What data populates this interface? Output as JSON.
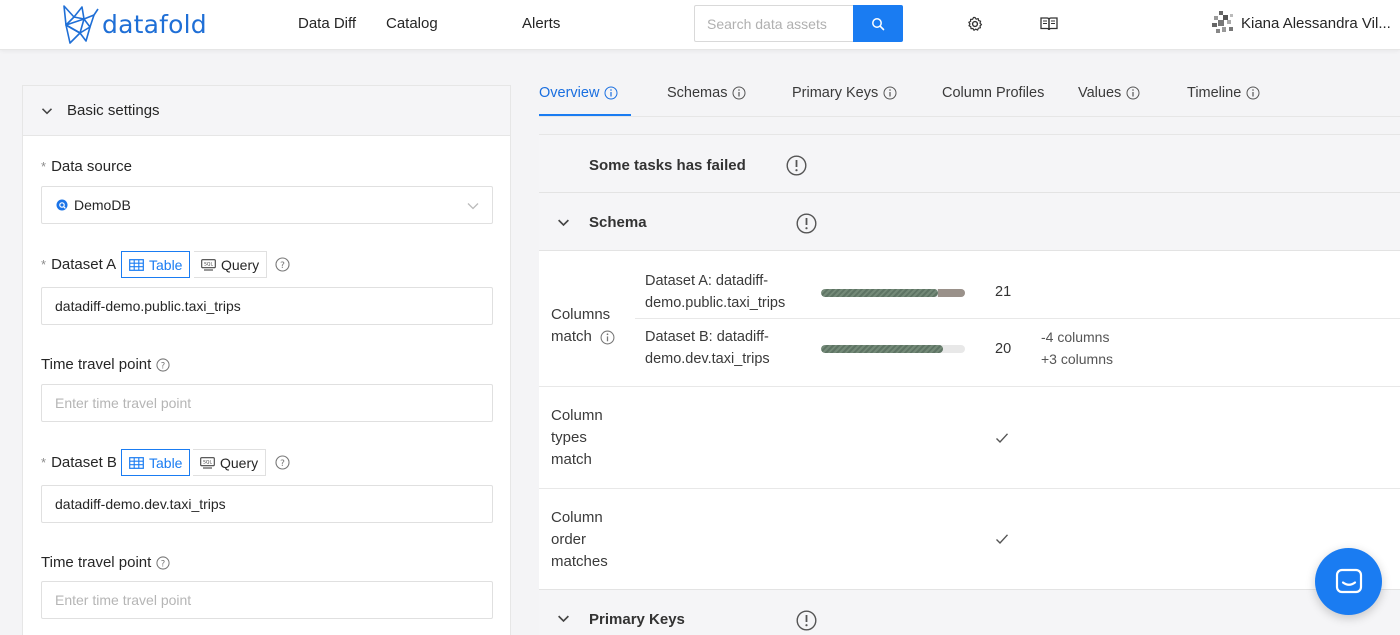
{
  "brand": {
    "name": "datafold",
    "color": "#1f6fd6"
  },
  "nav": {
    "items": [
      "Data Diff",
      "Catalog",
      "Alerts"
    ]
  },
  "search": {
    "placeholder": "Search data assets"
  },
  "user": {
    "name": "Kiana Alessandra Vil..."
  },
  "settings": {
    "title": "Basic settings",
    "data_source": {
      "label": "Data source",
      "value": "DemoDB"
    },
    "dataset_a": {
      "label": "Dataset A",
      "mode_table": "Table",
      "mode_query": "Query",
      "value": "datadiff-demo.public.taxi_trips"
    },
    "time_travel_a": {
      "label": "Time travel point",
      "placeholder": "Enter time travel point"
    },
    "dataset_b": {
      "label": "Dataset B",
      "mode_table": "Table",
      "mode_query": "Query",
      "value": "datadiff-demo.dev.taxi_trips"
    },
    "time_travel_b": {
      "label": "Time travel point",
      "placeholder": "Enter time travel point"
    }
  },
  "tabs": [
    {
      "label": "Overview",
      "active": true
    },
    {
      "label": "Schemas"
    },
    {
      "label": "Primary Keys"
    },
    {
      "label": "Column Profiles"
    },
    {
      "label": "Values"
    },
    {
      "label": "Timeline"
    }
  ],
  "overview": {
    "alert": "Some tasks has failed",
    "schema_title": "Schema",
    "columns_match": {
      "label_line1": "Columns",
      "label_line2": "match",
      "dataset_a_line1": "Dataset A: datadiff-",
      "dataset_a_line2": "demo.public.taxi_trips",
      "dataset_a_count": "21",
      "dataset_a_shared_fraction": 0.81,
      "dataset_b_line1": "Dataset B: datadiff-",
      "dataset_b_line2": "demo.dev.taxi_trips",
      "dataset_b_count": "20",
      "dataset_b_shared_fraction": 0.85,
      "removed": "-4 columns",
      "added": "+3 columns"
    },
    "column_types": {
      "line1": "Column",
      "line2": "types",
      "line3": "match"
    },
    "column_order": {
      "line1": "Column",
      "line2": "order",
      "line3": "matches"
    },
    "primary_keys_title": "Primary Keys"
  }
}
